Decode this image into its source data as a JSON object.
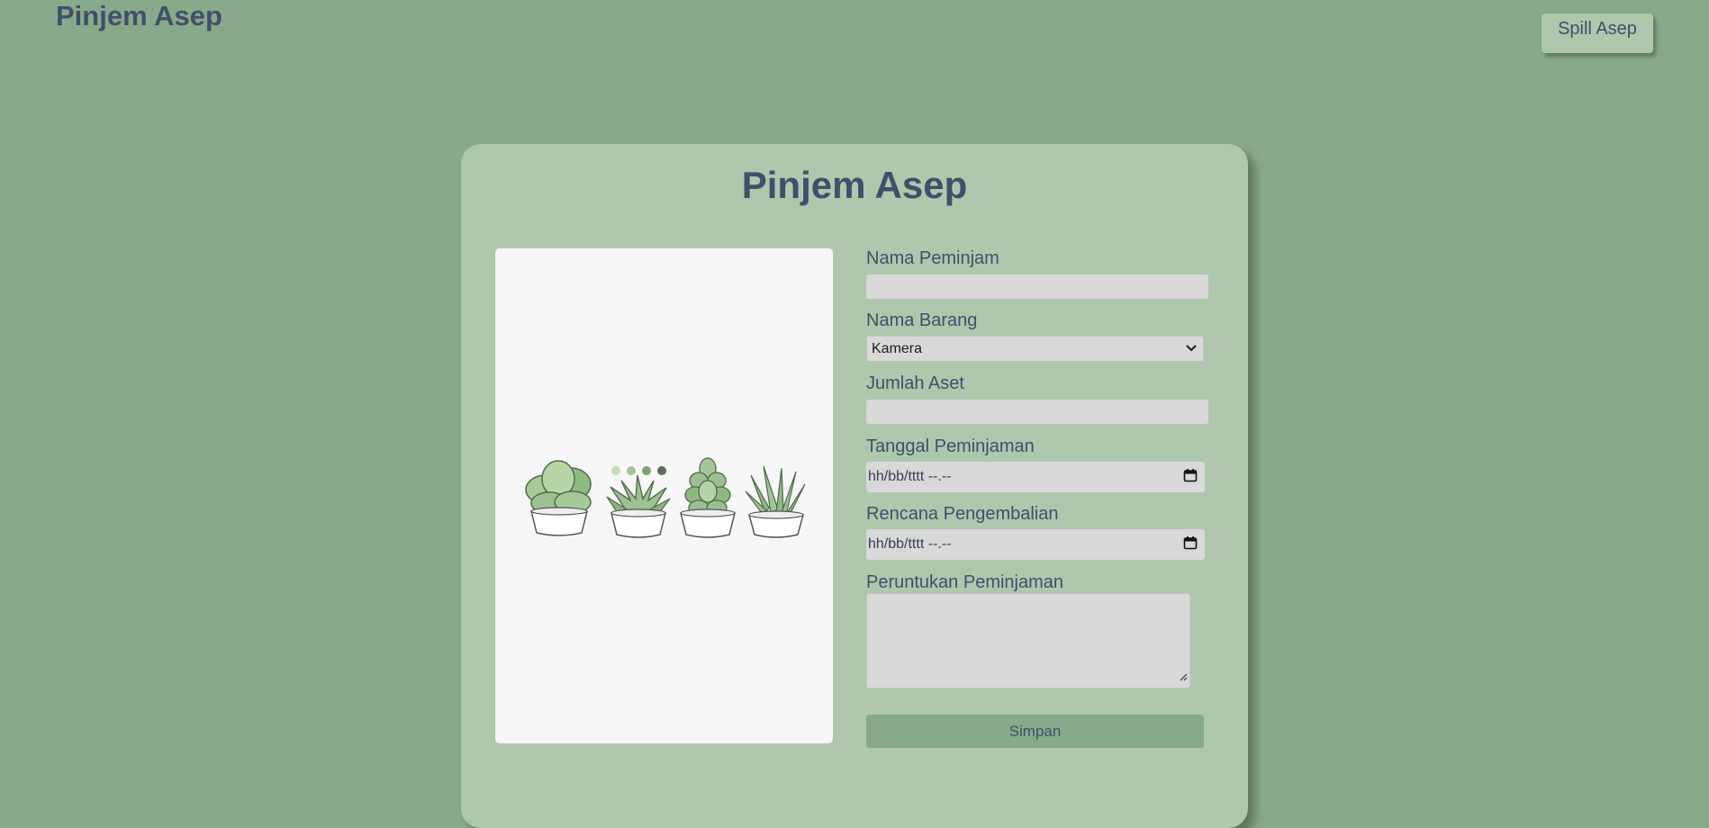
{
  "header": {
    "title": "Pinjem Asep",
    "spill_button_label": "Spill Asep"
  },
  "card": {
    "title": "Pinjem Asep"
  },
  "form": {
    "nama_peminjam": {
      "label": "Nama Peminjam",
      "value": ""
    },
    "nama_barang": {
      "label": "Nama Barang",
      "selected": "Kamera"
    },
    "jumlah_aset": {
      "label": "Jumlah Aset",
      "value": ""
    },
    "tanggal_peminjaman": {
      "label": "Tanggal Peminjaman",
      "placeholder": "hh/bb/tttt  --.--"
    },
    "rencana_pengembalian": {
      "label": "Rencana Pengembalian",
      "placeholder": "hh/bb/tttt  --.--"
    },
    "peruntukan": {
      "label": "Peruntukan Peminjaman",
      "value": ""
    },
    "submit_label": "Simpan"
  },
  "colors": {
    "background": "#88aa8b",
    "card": "#afc8ad",
    "text": "#434e6b",
    "field": "#d9d9d9"
  },
  "icons": {
    "select_arrow": "chevron-down-icon",
    "date_picker": "calendar-icon"
  }
}
